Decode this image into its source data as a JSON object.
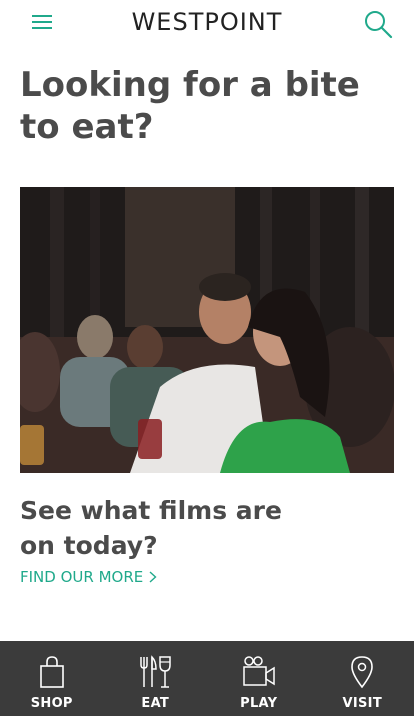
{
  "header": {
    "brand": "WESTPOINT",
    "menu_icon": "hamburger-menu-icon",
    "search_icon": "search-icon",
    "accent_color": "#20a98b"
  },
  "main": {
    "title": "Looking for a bite to eat?",
    "promo": {
      "image_alt": "Couple watching a film in a cinema",
      "heading": "See what films are on today?",
      "link_label": "FIND OUR MORE"
    }
  },
  "bottom_nav": {
    "background": "#3b3b3b",
    "items": [
      {
        "label": "SHOP",
        "icon": "shopping-bag-icon"
      },
      {
        "label": "EAT",
        "icon": "cutlery-wine-icon"
      },
      {
        "label": "PLAY",
        "icon": "video-camera-icon"
      },
      {
        "label": "VISIT",
        "icon": "location-pin-icon"
      }
    ]
  }
}
